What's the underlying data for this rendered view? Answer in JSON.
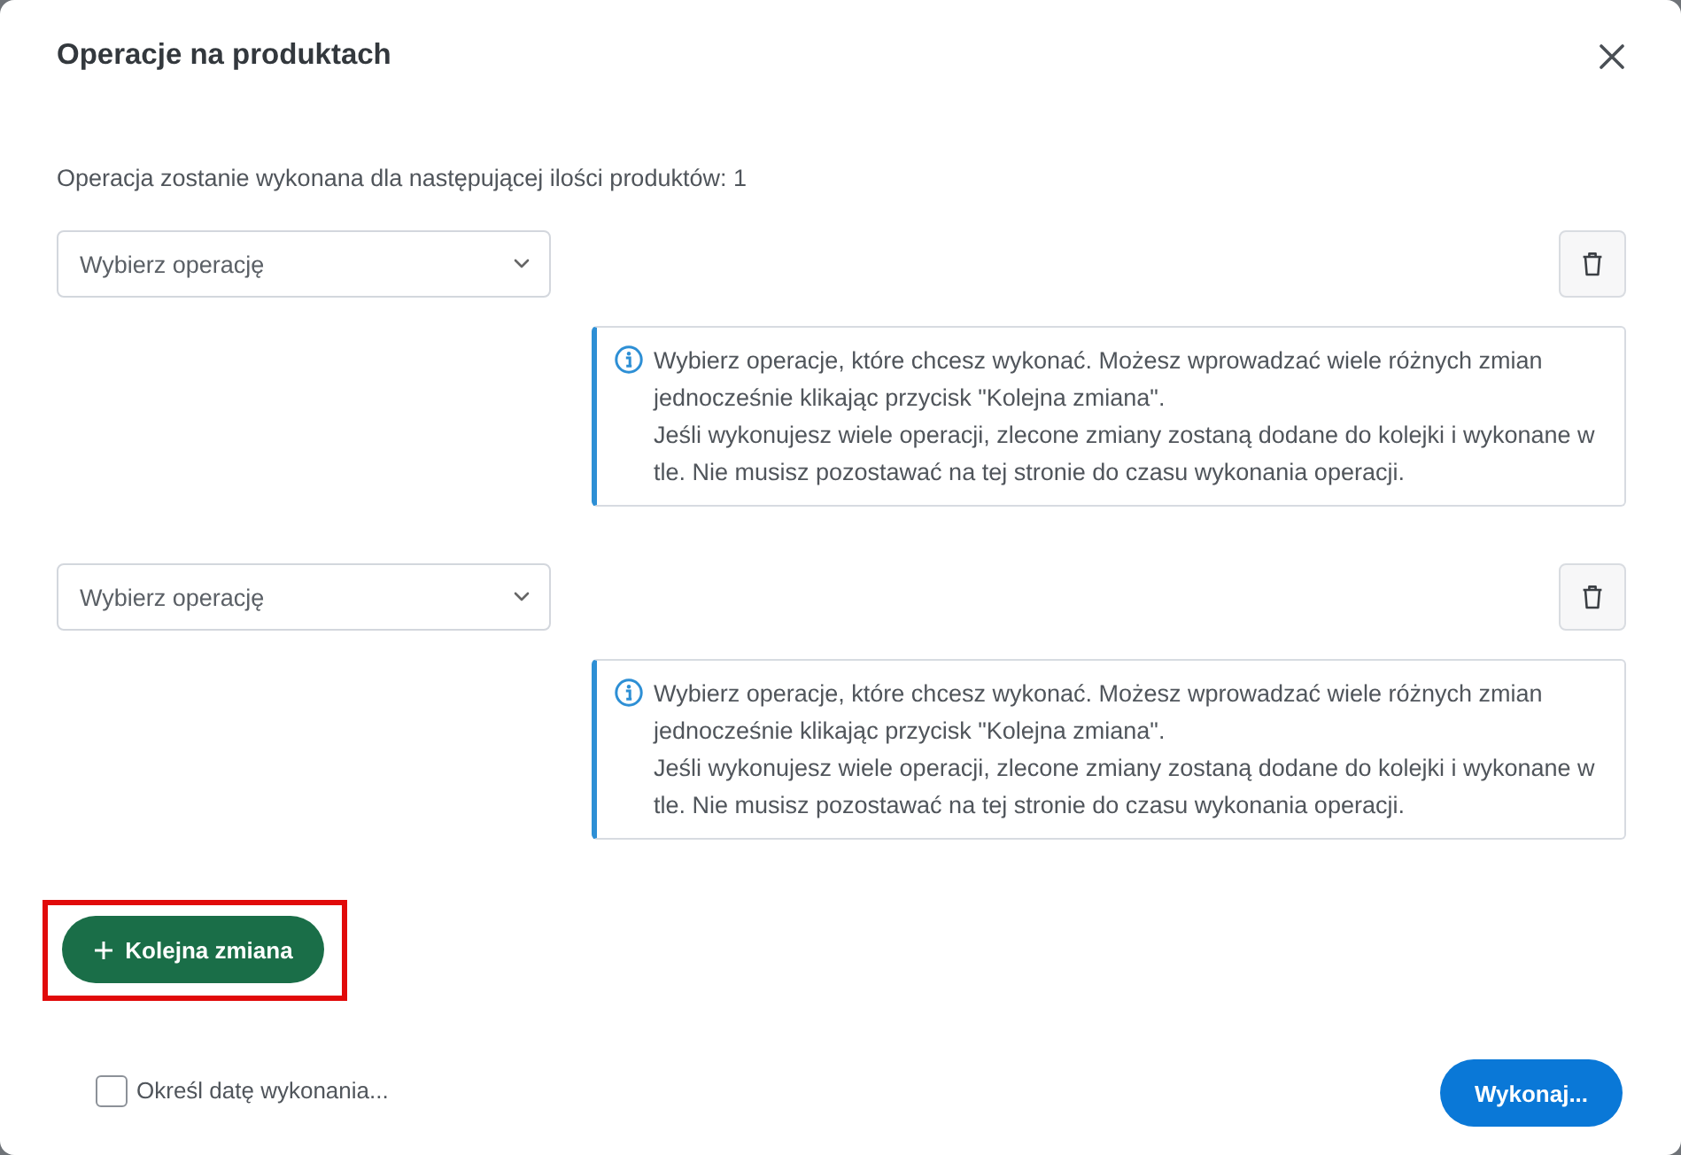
{
  "dialog": {
    "title": "Operacje na produktach"
  },
  "summary": "Operacja zostanie wykonana dla następującej ilości produktów: 1",
  "operations": [
    {
      "select": {
        "placeholder": "Wybierz operację"
      },
      "info": [
        "Wybierz operacje, które chcesz wykonać. Możesz wprowadzać wiele różnych zmian jednocześnie klikając przycisk \"Kolejna zmiana\".",
        "Jeśli wykonujesz wiele operacji, zlecone zmiany zostaną dodane do kolejki i wykonane w tle. Nie musisz pozostawać na tej stronie do czasu wykonania operacji."
      ]
    },
    {
      "select": {
        "placeholder": "Wybierz operację"
      },
      "info": [
        "Wybierz operacje, które chcesz wykonać. Możesz wprowadzać wiele różnych zmian jednocześnie klikając przycisk \"Kolejna zmiana\".",
        "Jeśli wykonujesz wiele operacji, zlecone zmiany zostaną dodane do kolejki i wykonane w tle. Nie musisz pozostawać na tej stronie do czasu wykonania operacji."
      ]
    }
  ],
  "add_button": {
    "label": "Kolejna zmiana",
    "highlighted": true
  },
  "schedule": {
    "label": "Określ datę wykonania...",
    "checked": false
  },
  "submit_button": {
    "label": "Wykonaj..."
  }
}
